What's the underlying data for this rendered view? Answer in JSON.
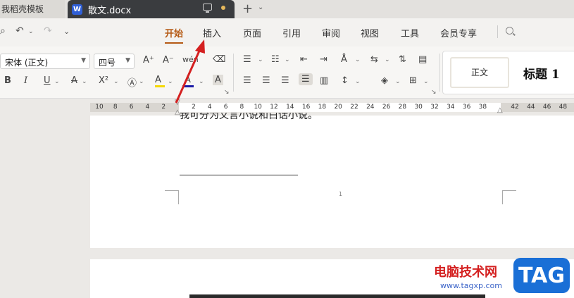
{
  "tabs": {
    "inactive_label": "我稻壳模板",
    "active_label": "散文.docx",
    "active_icon": "W"
  },
  "menu": {
    "items": [
      "开始",
      "插入",
      "页面",
      "引用",
      "审阅",
      "视图",
      "工具",
      "会员专享"
    ],
    "active_index": 0
  },
  "toolbar": {
    "font_name": "宋体 (正文)",
    "font_size": "四号",
    "format_font_size_up": "A⁺",
    "format_font_size_down": "A⁻",
    "phonetic": "wén",
    "bold": "B",
    "italic": "I",
    "underline": "U",
    "strikethrough": "A",
    "superscript": "X²",
    "highlight_label": "A",
    "font_color_label": "A",
    "char_shading_label": "A"
  },
  "styles": {
    "normal": "正文",
    "heading1": "标题 1"
  },
  "ruler": {
    "left_numbers": [
      "10",
      "8",
      "6",
      "4",
      "2"
    ],
    "right_numbers": [
      "2",
      "4",
      "6",
      "8",
      "10",
      "12",
      "14",
      "16",
      "18",
      "20",
      "22",
      "24",
      "26",
      "28",
      "30",
      "32",
      "34",
      "36",
      "38",
      "42",
      "44",
      "46",
      "48"
    ]
  },
  "document": {
    "cut_text": "我可分为文言小说和白话小说。",
    "page_number": "1"
  },
  "colors": {
    "accent": "#b55a14",
    "font_color_bar": "#1a1aa6",
    "highlight_bar": "#f5d800",
    "arrow": "#d42020"
  },
  "watermark": {
    "text": "电脑技术网",
    "url": "www.tagxp.com",
    "badge": "TAG"
  }
}
